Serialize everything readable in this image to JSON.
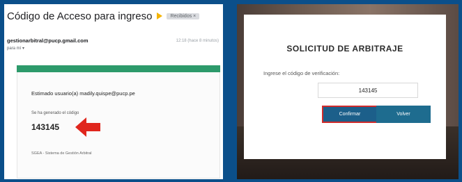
{
  "email": {
    "subject": "Código de Acceso para ingreso",
    "label_chip": "Recibidos ×",
    "sender": "gestionarbitral@pucp.gmail.com",
    "time": "12:18 (hace 8 minutos)",
    "recipient": "para mí ▾",
    "greeting": "Estimado usuario(a) madily.quispe@pucp.pe",
    "generated_text": "Se ha generado el código",
    "code": "143145",
    "footer": "SGEA - Sistema de Gestión Arbitral",
    "colors": {
      "card_bar": "#2d9a6b",
      "arrow": "#e0261d"
    }
  },
  "dialog": {
    "title": "SOLICITUD DE ARBITRAJE",
    "label": "Ingrese el código de verificación:",
    "input_value": "143145",
    "confirm_label": "Confirmar",
    "back_label": "Volver",
    "colors": {
      "button": "#1c5f8a",
      "highlight": "#d12b2b"
    }
  }
}
